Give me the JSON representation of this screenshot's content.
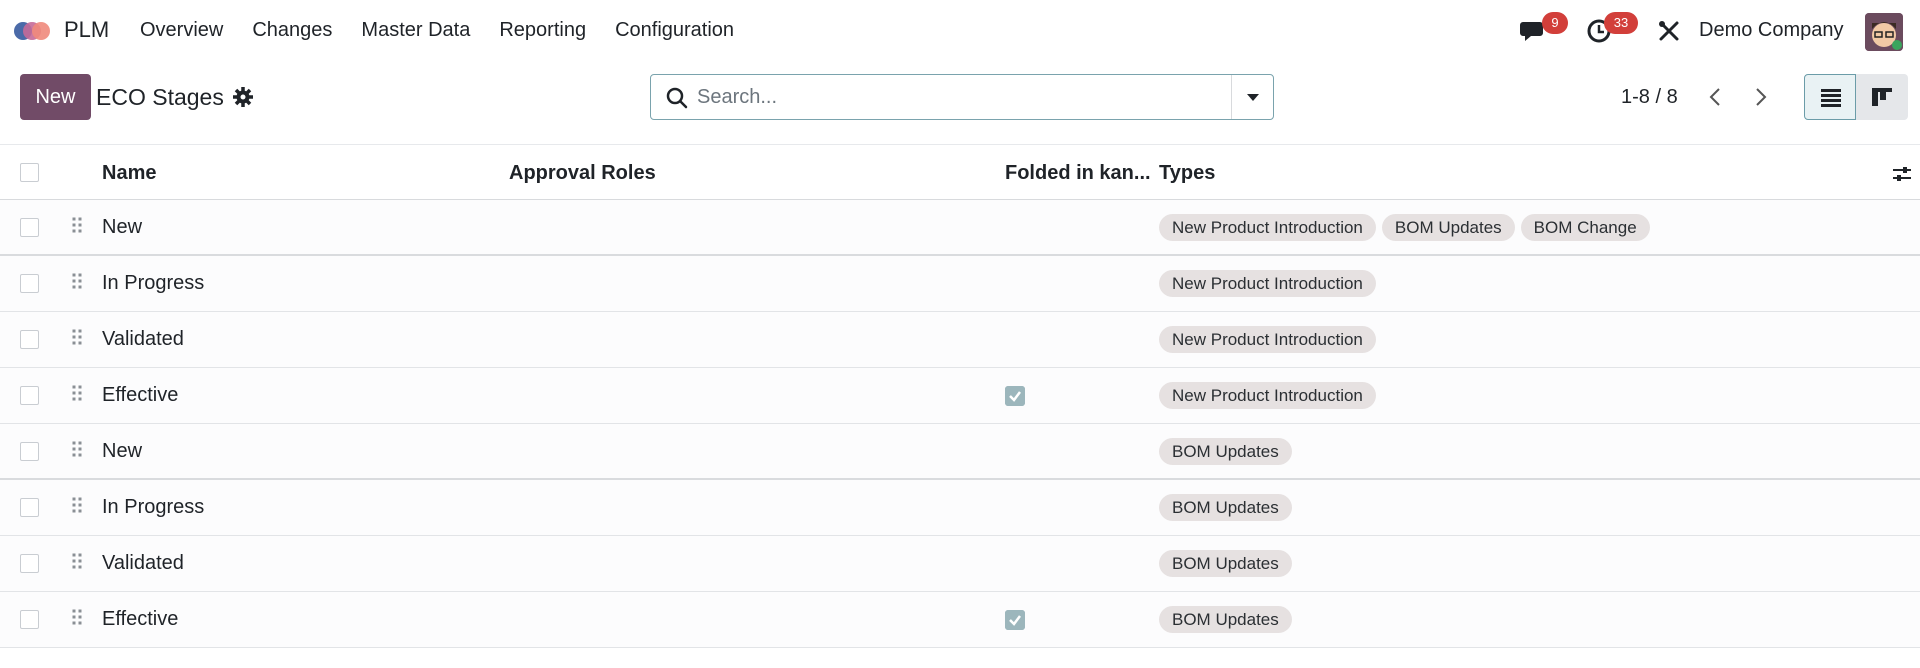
{
  "navbar": {
    "app_name": "PLM",
    "menu": [
      "Overview",
      "Changes",
      "Master Data",
      "Reporting",
      "Configuration"
    ],
    "messages_count": "9",
    "activities_count": "33",
    "company": "Demo Company"
  },
  "control": {
    "new_label": "New",
    "title": "ECO Stages",
    "search_placeholder": "Search...",
    "pager": "1-8 / 8"
  },
  "table": {
    "columns": [
      "Name",
      "Approval Roles",
      "Folded in kan...",
      "Types"
    ],
    "rows": [
      {
        "name": "New",
        "folded": false,
        "types": [
          "New Product Introduction",
          "BOM Updates",
          "BOM Change"
        ]
      },
      {
        "name": "In Progress",
        "folded": false,
        "types": [
          "New Product Introduction"
        ]
      },
      {
        "name": "Validated",
        "folded": false,
        "types": [
          "New Product Introduction"
        ]
      },
      {
        "name": "Effective",
        "folded": true,
        "types": [
          "New Product Introduction"
        ]
      },
      {
        "name": "New",
        "folded": false,
        "types": [
          "BOM Updates"
        ]
      },
      {
        "name": "In Progress",
        "folded": false,
        "types": [
          "BOM Updates"
        ]
      },
      {
        "name": "Validated",
        "folded": false,
        "types": [
          "BOM Updates"
        ]
      },
      {
        "name": "Effective",
        "folded": true,
        "types": [
          "BOM Updates"
        ]
      }
    ]
  },
  "colors": {
    "primary": "#714b67",
    "badge": "#d23f3a",
    "tag_bg": "#e6e1e1",
    "checked": "#9cb6bc"
  }
}
